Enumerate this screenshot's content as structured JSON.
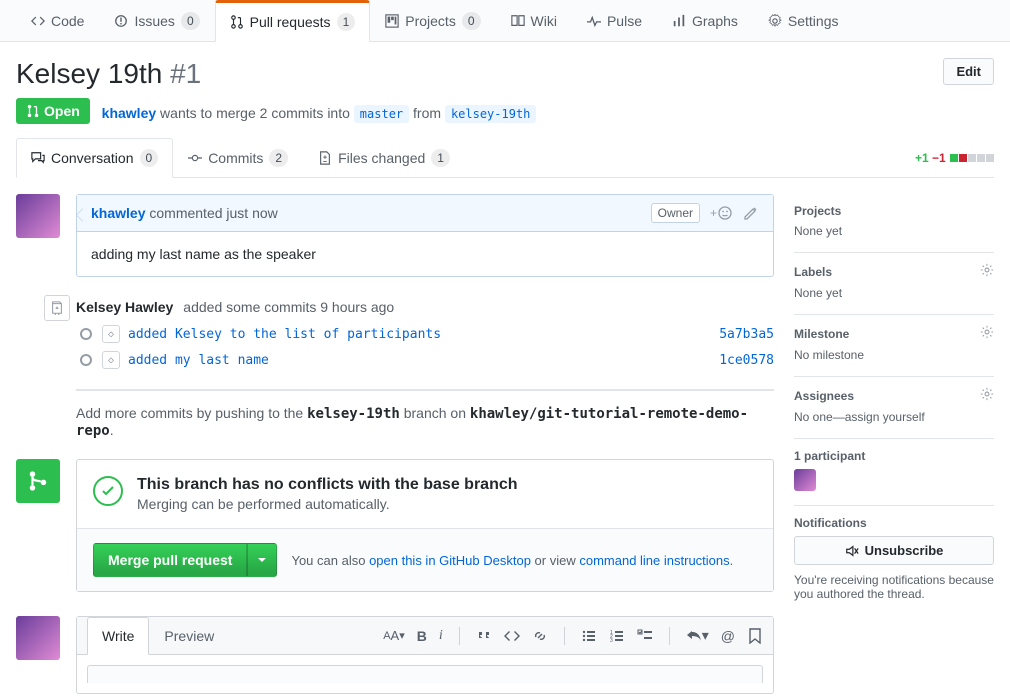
{
  "reponav": {
    "code": "Code",
    "issues": "Issues",
    "issues_count": "0",
    "pulls": "Pull requests",
    "pulls_count": "1",
    "projects": "Projects",
    "projects_count": "0",
    "wiki": "Wiki",
    "pulse": "Pulse",
    "graphs": "Graphs",
    "settings": "Settings"
  },
  "pr": {
    "title": "Kelsey 19th",
    "number": "#1",
    "edit": "Edit",
    "state": "Open",
    "author": "khawley",
    "merge_text_mid": " wants to merge 2 commits into ",
    "base": "master",
    "from_text": " from ",
    "head": "kelsey-19th"
  },
  "tabs": {
    "conversation": "Conversation",
    "conversation_count": "0",
    "commits": "Commits",
    "commits_count": "2",
    "files": "Files changed",
    "files_count": "1"
  },
  "diffstat": {
    "plus": "+1",
    "minus": "−1"
  },
  "discussion": {
    "owner_label": "Owner",
    "author": "khawley",
    "time_text": " commented just now",
    "body": "adding my last name as the speaker"
  },
  "commits": {
    "actor": "Kelsey Hawley",
    "action_text": " added some commits 9 hours ago",
    "items": [
      {
        "msg": "added Kelsey to the list of participants",
        "sha": "5a7b3a5"
      },
      {
        "msg": "added my last name",
        "sha": "1ce0578"
      }
    ]
  },
  "push_hint": {
    "pre": "Add more commits by pushing to the ",
    "branch": "kelsey-19th",
    "mid": " branch on ",
    "repo": "khawley/git-tutorial-remote-demo-repo",
    "end": "."
  },
  "merge": {
    "title": "This branch has no conflicts with the base branch",
    "sub": "Merging can be performed automatically.",
    "button": "Merge pull request",
    "also_pre": "You can also ",
    "also_link1": "open this in GitHub Desktop",
    "also_mid": " or view ",
    "also_link2": "command line instructions",
    "also_end": "."
  },
  "new_comment": {
    "write": "Write",
    "preview": "Preview"
  },
  "sidebar": {
    "projects": {
      "title": "Projects",
      "value": "None yet"
    },
    "labels": {
      "title": "Labels",
      "value": "None yet"
    },
    "milestone": {
      "title": "Milestone",
      "value": "No milestone"
    },
    "assignees": {
      "title": "Assignees",
      "value": "No one—assign yourself"
    },
    "participants": {
      "title": "1 participant"
    },
    "notifications": {
      "title": "Notifications",
      "button": "Unsubscribe",
      "note": "You're receiving notifications because you authored the thread."
    }
  }
}
